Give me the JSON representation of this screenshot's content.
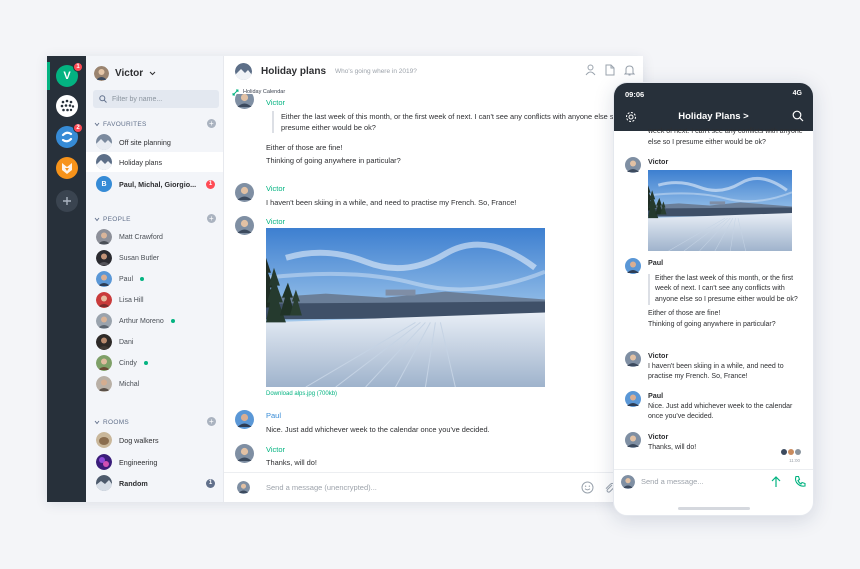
{
  "desktop": {
    "communities": [
      {
        "letter": "V",
        "color": "#03b381",
        "badge": "1"
      },
      {
        "letter": "",
        "color": "#ffffff",
        "badge": ""
      },
      {
        "letter": "",
        "color": "#368bd6",
        "badge": "2"
      },
      {
        "letter": "",
        "color": "#f7931a",
        "badge": ""
      }
    ],
    "user_name": "Victor",
    "filter_placeholder": "Filter by name...",
    "sections": {
      "favourites": "FAVOURITES",
      "people": "PEOPLE",
      "rooms": "ROOMS"
    },
    "favourites": [
      {
        "name": "Off site planning",
        "count": ""
      },
      {
        "name": "Holiday plans",
        "count": ""
      },
      {
        "name": "Paul, Michal, Giorgio...",
        "count": "1",
        "avatar_letter": "B",
        "count_color": "#ff4b55"
      }
    ],
    "people": [
      {
        "name": "Matt Crawford",
        "online": false
      },
      {
        "name": "Susan Butler",
        "online": false
      },
      {
        "name": "Paul",
        "online": true
      },
      {
        "name": "Lisa Hill",
        "online": false
      },
      {
        "name": "Arthur Moreno",
        "online": true
      },
      {
        "name": "Dani",
        "online": false
      },
      {
        "name": "Cindy",
        "online": true
      },
      {
        "name": "Michal",
        "online": false
      }
    ],
    "rooms": [
      {
        "name": "Dog walkers",
        "count": ""
      },
      {
        "name": "Engineering",
        "count": ""
      },
      {
        "name": "Random",
        "count": "1",
        "count_color": "#61708b"
      }
    ],
    "room_title": "Holiday plans",
    "room_topic": "Who's going where in 2019?",
    "widget_label": "Holiday Calendar",
    "messages": [
      {
        "sender": "Victor",
        "quote": "Either the last week of this month, or the first week of next. I can't see any conflicts with anyone else so I presume either would be ok?"
      },
      {
        "text1": "Either of those are fine!",
        "text2": "Thinking of going anywhere in particular?"
      },
      {
        "sender": "Victor",
        "text": "I haven't been skiing in a while, and need to practise my French. So, France!"
      },
      {
        "sender": "Victor"
      },
      {
        "sender": "Paul",
        "text": "Nice. Just add whichever week to the calendar once you've decided."
      },
      {
        "sender": "Victor",
        "text": "Thanks, will do!"
      }
    ],
    "download_label": "Download alps.jpg (700kb)",
    "composer_placeholder": "Send a message (unencrypted)..."
  },
  "phone": {
    "time": "09:06",
    "signal": "4G",
    "title": "Holiday Plans >",
    "top_text": "week of next. I can't see any conflicts with anyone else so I presume either would be ok?",
    "messages": [
      {
        "sender": "Victor"
      },
      {
        "sender": "Paul",
        "quote": "Either the last week of this month, or the first week of next. I can't see any conflicts with anyone else so I presume either would be ok?",
        "text1": "Either of those are fine!",
        "text2": "Thinking of going anywhere in particular?"
      },
      {
        "sender": "Victor",
        "text": "I haven't been skiing in a while, and need to practise my French. So, France!"
      },
      {
        "sender": "Paul",
        "text": "Nice. Just add whichever week to the calendar once you've decided."
      },
      {
        "sender": "Victor",
        "text": "Thanks, will do!"
      }
    ],
    "read_time": "11:00",
    "composer_placeholder": "Send a message..."
  },
  "colors": {
    "accent": "#03b381",
    "rail": "#27303a",
    "paul": "#368bd6",
    "badge": "#ff4b55"
  }
}
